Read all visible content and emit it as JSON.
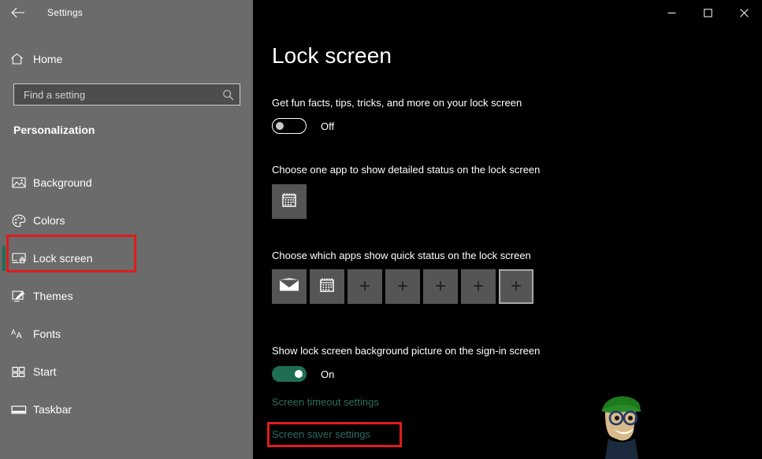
{
  "window": {
    "app_title": "Settings",
    "back_icon": "back-arrow-icon",
    "controls": {
      "minimize_label": "Minimize",
      "maximize_label": "Maximize",
      "close_label": "Close"
    }
  },
  "sidebar": {
    "home": {
      "label": "Home",
      "icon": "home-icon"
    },
    "search": {
      "placeholder": "Find a setting",
      "value": "",
      "icon": "search-icon"
    },
    "section_header": "Personalization",
    "items": [
      {
        "label": "Background",
        "icon": "image-icon",
        "selected": false
      },
      {
        "label": "Colors",
        "icon": "palette-icon",
        "selected": false
      },
      {
        "label": "Lock screen",
        "icon": "lock-screen-icon",
        "selected": true
      },
      {
        "label": "Themes",
        "icon": "themes-icon",
        "selected": false
      },
      {
        "label": "Fonts",
        "icon": "fonts-icon",
        "selected": false
      },
      {
        "label": "Start",
        "icon": "start-icon",
        "selected": false
      },
      {
        "label": "Taskbar",
        "icon": "taskbar-icon",
        "selected": false
      }
    ]
  },
  "main": {
    "page_title": "Lock screen",
    "fun_facts": {
      "label": "Get fun facts, tips, tricks, and more on your lock screen",
      "toggle_state": "Off",
      "toggle_on": false
    },
    "detailed_status": {
      "label": "Choose one app to show detailed status on the lock screen",
      "tile": {
        "icon": "calendar-icon",
        "name": "Calendar"
      }
    },
    "quick_status": {
      "label": "Choose which apps show quick status on the lock screen",
      "tiles": [
        {
          "icon": "mail-icon",
          "name": "Mail",
          "type": "app",
          "focused": false
        },
        {
          "icon": "calendar-icon",
          "name": "Calendar",
          "type": "app",
          "focused": false
        },
        {
          "icon": "plus-icon",
          "name": "Add app",
          "type": "add",
          "focused": false
        },
        {
          "icon": "plus-icon",
          "name": "Add app",
          "type": "add",
          "focused": false
        },
        {
          "icon": "plus-icon",
          "name": "Add app",
          "type": "add",
          "focused": false
        },
        {
          "icon": "plus-icon",
          "name": "Add app",
          "type": "add",
          "focused": false
        },
        {
          "icon": "plus-icon",
          "name": "Add app",
          "type": "add",
          "focused": true
        }
      ]
    },
    "sign_in_picture": {
      "label": "Show lock screen background picture on the sign-in screen",
      "toggle_state": "On",
      "toggle_on": true
    },
    "links": [
      {
        "label": "Screen timeout settings",
        "highlighted": false
      },
      {
        "label": "Screen saver settings",
        "highlighted": true
      }
    ]
  },
  "annotations": {
    "color": "#e01b1b",
    "boxes": [
      {
        "target": "sidebar-item-lock-screen"
      },
      {
        "target": "link-screen-saver-settings"
      }
    ]
  },
  "colors": {
    "sidebar_bg": "#6b6b6b",
    "main_bg": "#000000",
    "accent": "#1f6e53",
    "link": "#2e6e5e",
    "tile_bg": "#555555",
    "annotation_red": "#e01b1b"
  },
  "watermark": {
    "name": "cartoon-character-watermark"
  }
}
